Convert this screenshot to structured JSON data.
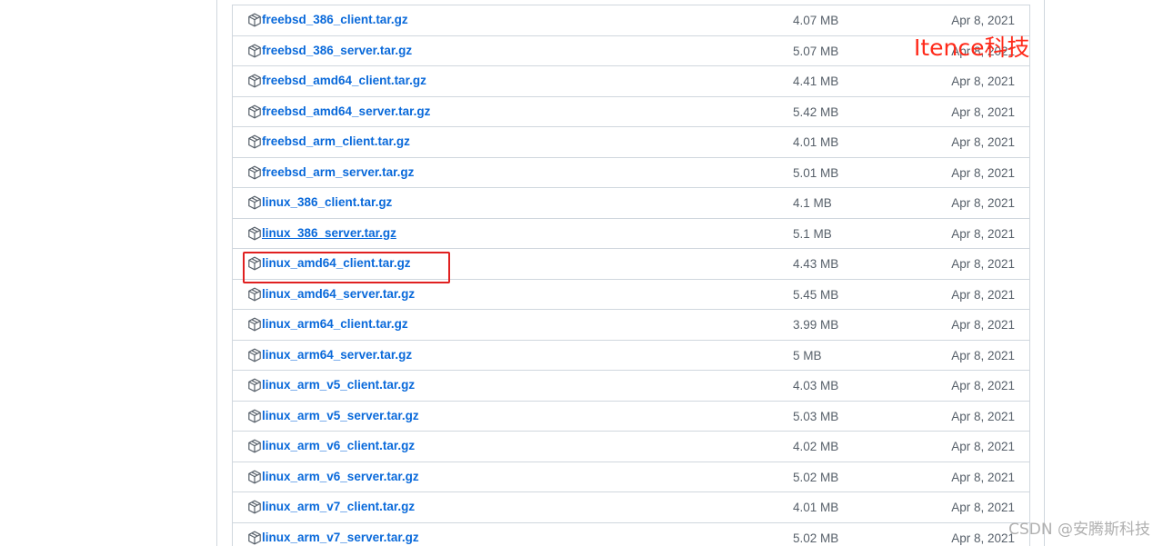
{
  "assets": [
    {
      "name": "freebsd_386_client.tar.gz",
      "size": "4.07 MB",
      "date": "Apr 8, 2021"
    },
    {
      "name": "freebsd_386_server.tar.gz",
      "size": "5.07 MB",
      "date": "Apr 8, 2021"
    },
    {
      "name": "freebsd_amd64_client.tar.gz",
      "size": "4.41 MB",
      "date": "Apr 8, 2021"
    },
    {
      "name": "freebsd_amd64_server.tar.gz",
      "size": "5.42 MB",
      "date": "Apr 8, 2021"
    },
    {
      "name": "freebsd_arm_client.tar.gz",
      "size": "4.01 MB",
      "date": "Apr 8, 2021"
    },
    {
      "name": "freebsd_arm_server.tar.gz",
      "size": "5.01 MB",
      "date": "Apr 8, 2021"
    },
    {
      "name": "linux_386_client.tar.gz",
      "size": "4.1 MB",
      "date": "Apr 8, 2021"
    },
    {
      "name": "linux_386_server.tar.gz",
      "size": "5.1 MB",
      "date": "Apr 8, 2021"
    },
    {
      "name": "linux_amd64_client.tar.gz",
      "size": "4.43 MB",
      "date": "Apr 8, 2021"
    },
    {
      "name": "linux_amd64_server.tar.gz",
      "size": "5.45 MB",
      "date": "Apr 8, 2021"
    },
    {
      "name": "linux_arm64_client.tar.gz",
      "size": "3.99 MB",
      "date": "Apr 8, 2021"
    },
    {
      "name": "linux_arm64_server.tar.gz",
      "size": "5 MB",
      "date": "Apr 8, 2021"
    },
    {
      "name": "linux_arm_v5_client.tar.gz",
      "size": "4.03 MB",
      "date": "Apr 8, 2021"
    },
    {
      "name": "linux_arm_v5_server.tar.gz",
      "size": "5.03 MB",
      "date": "Apr 8, 2021"
    },
    {
      "name": "linux_arm_v6_client.tar.gz",
      "size": "4.02 MB",
      "date": "Apr 8, 2021"
    },
    {
      "name": "linux_arm_v6_server.tar.gz",
      "size": "5.02 MB",
      "date": "Apr 8, 2021"
    },
    {
      "name": "linux_arm_v7_client.tar.gz",
      "size": "4.01 MB",
      "date": "Apr 8, 2021"
    },
    {
      "name": "linux_arm_v7_server.tar.gz",
      "size": "5.02 MB",
      "date": "Apr 8, 2021"
    }
  ],
  "icon": "package-icon",
  "hovered_asset": "linux_386_server.tar.gz",
  "highlighted_asset": "linux_amd64_client.tar.gz",
  "colors": {
    "link": "#0969da",
    "muted": "#57606a",
    "highlight_box": "#e02020",
    "watermark_top": "#ff2a1a"
  },
  "watermark_top": "Itence科技",
  "watermark_bottom": "CSDN @安腾斯科技"
}
